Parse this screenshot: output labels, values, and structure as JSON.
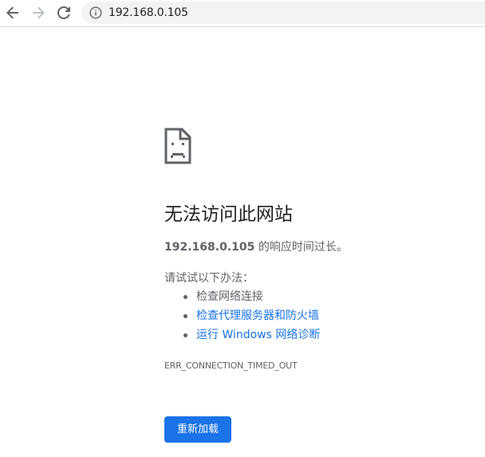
{
  "browser": {
    "back_icon": "arrow-left-icon",
    "forward_icon": "arrow-right-icon",
    "reload_icon": "reload-icon",
    "site_info_icon": "info-icon",
    "url": "192.168.0.105"
  },
  "error_page": {
    "icon": "sad-page-icon",
    "heading": "无法访问此网站",
    "host": "192.168.0.105",
    "description_suffix": " 的响应时间过长。",
    "try_label": "请试试以下办法：",
    "suggestions": [
      {
        "text": "检查网络连接",
        "is_link": false
      },
      {
        "text": "检查代理服务器和防火墙",
        "is_link": true
      },
      {
        "text": "运行 Windows 网络诊断",
        "is_link": true
      }
    ],
    "error_code": "ERR_CONNECTION_TIMED_OUT",
    "reload_label": "重新加载"
  },
  "colors": {
    "accent": "#1a73e8",
    "text": "#202124",
    "secondary_text": "#5f6368",
    "omnibox_bg": "#f1f3f4"
  }
}
